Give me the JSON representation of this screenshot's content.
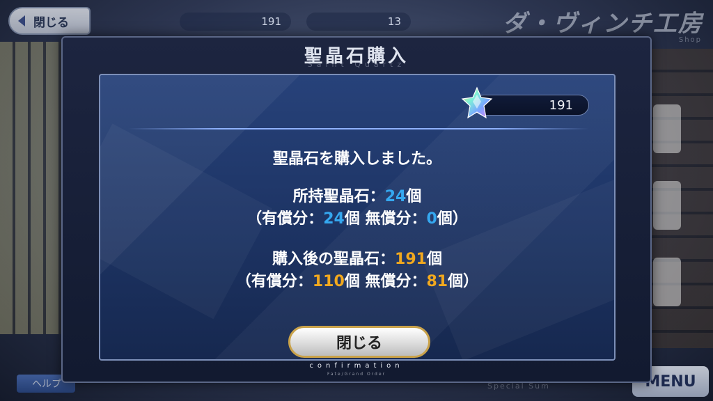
{
  "background": {
    "back_label": "閉じる",
    "counter_quartz": "191",
    "counter_other": "13",
    "screen_title": "ダ・ヴィンチ工房",
    "screen_subtitle": "Shop",
    "help_label": "ヘルプ",
    "menu_label": "MENU",
    "bottom_text": "Special Sum"
  },
  "dialog": {
    "title": "聖晶石購入",
    "subtitle": "Saint Quartz",
    "quartz_balance": "191",
    "message": "聖晶石を購入しました。",
    "owned": {
      "label": "所持聖晶石：",
      "total": "24",
      "unit": "個",
      "paren_open": "（有償分：",
      "paid": "24",
      "mid": "個 無償分：",
      "free": "0",
      "paren_close": "個）"
    },
    "after": {
      "label": "購入後の聖晶石：",
      "total": "191",
      "unit": "個",
      "paren_open": "（有償分：",
      "paid": "110",
      "mid": "個 無償分：",
      "free": "81",
      "paren_close": "個）"
    },
    "close_label": "閉じる",
    "footer": "confirmation",
    "footer_sub": "Fate/Grand Order"
  },
  "colors": {
    "highlight_blue": "#35a8f0",
    "highlight_orange": "#f2a91e",
    "panel": "#1c3261"
  },
  "icons": {
    "quartz": "saint-quartz-icon",
    "back": "chevron-left-icon"
  }
}
